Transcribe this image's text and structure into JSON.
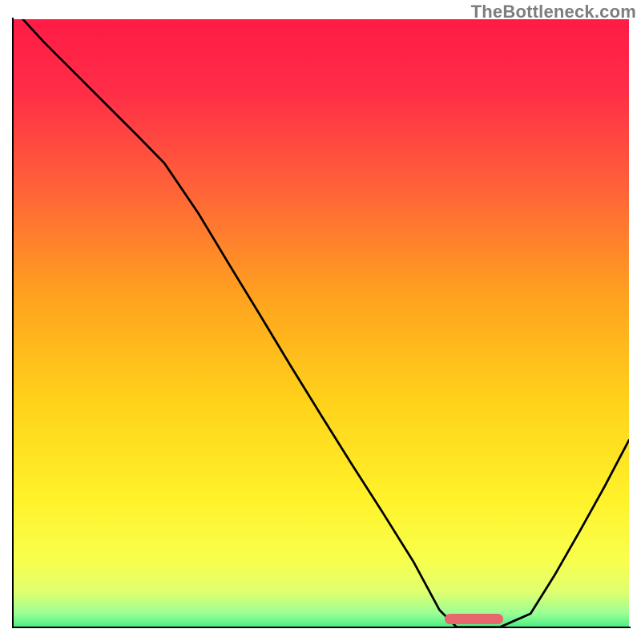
{
  "watermark": "TheBottleneck.com",
  "colors": {
    "gradient_stops": [
      {
        "offset": 0.0,
        "color": "#ff1b46"
      },
      {
        "offset": 0.12,
        "color": "#ff2e47"
      },
      {
        "offset": 0.28,
        "color": "#ff6438"
      },
      {
        "offset": 0.45,
        "color": "#ffa21f"
      },
      {
        "offset": 0.62,
        "color": "#ffd21a"
      },
      {
        "offset": 0.78,
        "color": "#fff22a"
      },
      {
        "offset": 0.88,
        "color": "#f8ff4d"
      },
      {
        "offset": 0.93,
        "color": "#e0ff6f"
      },
      {
        "offset": 0.965,
        "color": "#9dff95"
      },
      {
        "offset": 1.0,
        "color": "#20e57b"
      }
    ],
    "curve": "#000000",
    "optimum_marker": "#e8676c",
    "watermark": "#7d7d7d"
  },
  "chart_data": {
    "type": "line",
    "title": "",
    "xlabel": "",
    "ylabel": "",
    "xlim": [
      0,
      1
    ],
    "ylim": [
      0,
      1
    ],
    "x": [
      0.015,
      0.05,
      0.1,
      0.15,
      0.2,
      0.245,
      0.3,
      0.35,
      0.4,
      0.45,
      0.5,
      0.55,
      0.6,
      0.65,
      0.692,
      0.72,
      0.79,
      0.84,
      0.88,
      0.92,
      0.96,
      1.0
    ],
    "values": [
      1.0,
      0.962,
      0.912,
      0.862,
      0.812,
      0.766,
      0.685,
      0.602,
      0.52,
      0.437,
      0.356,
      0.276,
      0.198,
      0.118,
      0.04,
      0.012,
      0.012,
      0.034,
      0.098,
      0.168,
      0.24,
      0.316
    ],
    "optimum_range": {
      "x_start": 0.7,
      "x_end": 0.795,
      "y": 0.012
    }
  }
}
